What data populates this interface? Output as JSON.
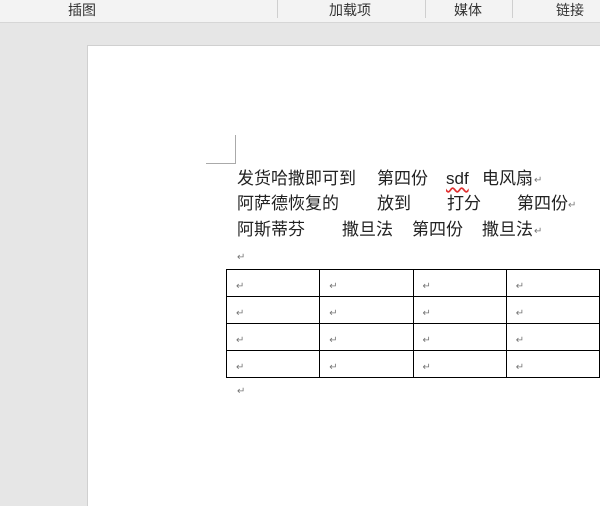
{
  "ribbon_tabs": [
    "插图",
    "加载项",
    "媒体",
    "链接"
  ],
  "document": {
    "lines": [
      [
        "发货哈撒即可到",
        "第四份",
        "sdf",
        "电风扇"
      ],
      [
        "阿萨德恢复的",
        "放到",
        "打分",
        "第四份"
      ],
      [
        "阿斯蒂芬",
        "撒旦法",
        "第四份",
        "撒旦法"
      ]
    ],
    "paragraph_mark": "↵",
    "table": {
      "rows": 4,
      "cols": 4
    }
  }
}
